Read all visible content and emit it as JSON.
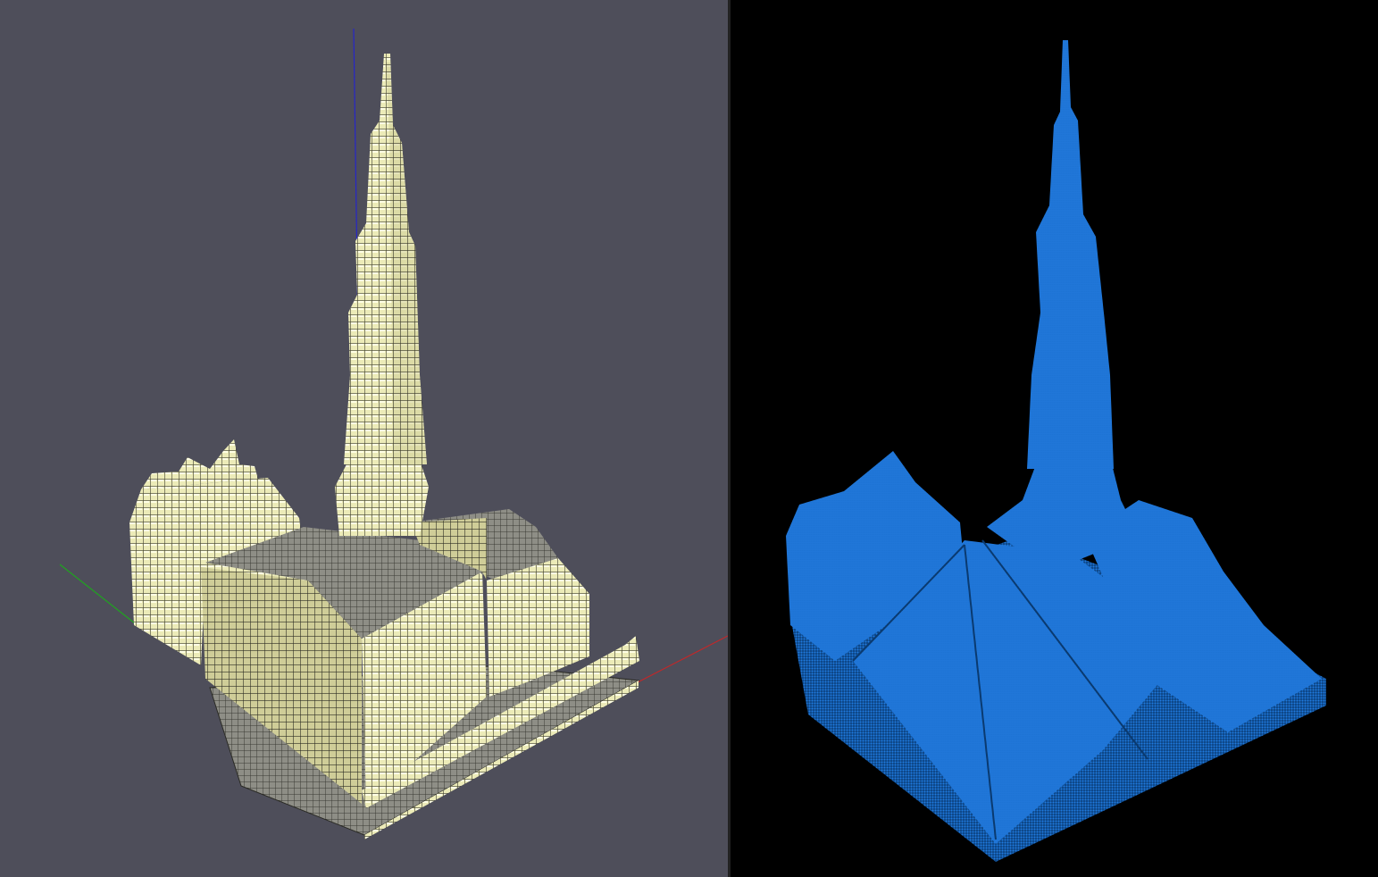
{
  "views": {
    "left": {
      "background": "#4e4e5a",
      "render_style": "voxel-cubes",
      "voxel_color": "#ecebb8",
      "voxel_edge_color": "#3a3a2e",
      "axes": {
        "x_color": "#c0282a",
        "y_color": "#1fa51f",
        "z_color": "#2626c8"
      }
    },
    "right": {
      "background": "#000000",
      "render_style": "point-cloud",
      "point_color": "#1f7ae0"
    }
  }
}
